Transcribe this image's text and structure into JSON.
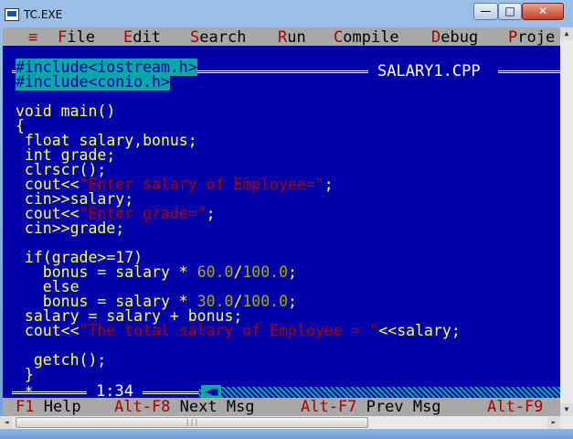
{
  "window": {
    "title": "TC.EXE",
    "minimize_glyph": "—",
    "maximize_glyph": "□",
    "close_glyph": "✕",
    "icon": "dos-app-icon"
  },
  "menu": {
    "system_glyph": "≡",
    "items": [
      {
        "hotkey": "F",
        "rest": "ile"
      },
      {
        "hotkey": "E",
        "rest": "dit"
      },
      {
        "hotkey": "S",
        "rest": "earch"
      },
      {
        "hotkey": "R",
        "rest": "un"
      },
      {
        "hotkey": "C",
        "rest": "ompile"
      },
      {
        "hotkey": "D",
        "rest": "ebug"
      },
      {
        "hotkey": "P",
        "rest": "roje"
      }
    ]
  },
  "editor": {
    "close_box_open": "[",
    "close_box_mark": "■",
    "close_box_close": "]",
    "file_name": "SALARY1.CPP",
    "cursor_position": "1:34",
    "scroll_left_glyph": "◄■",
    "lines": [
      [
        {
          "t": "#include<iostream.h>",
          "c": "inc"
        }
      ],
      [
        {
          "t": "#include<conio.h>",
          "c": "inc"
        }
      ],
      [
        {
          "t": "",
          "c": "plain"
        }
      ],
      [
        {
          "t": "void main()",
          "c": "plain"
        }
      ],
      [
        {
          "t": "{",
          "c": "plain"
        }
      ],
      [
        {
          "t": " float salary,bonus;",
          "c": "plain"
        }
      ],
      [
        {
          "t": " int grade;",
          "c": "plain"
        }
      ],
      [
        {
          "t": " clrscr();",
          "c": "plain"
        }
      ],
      [
        {
          "t": " cout<<",
          "c": "plain"
        },
        {
          "t": "\"Enter salary of Employee=\"",
          "c": "str"
        },
        {
          "t": ";",
          "c": "plain"
        }
      ],
      [
        {
          "t": " cin>>salary;",
          "c": "plain"
        }
      ],
      [
        {
          "t": " cout<<",
          "c": "plain"
        },
        {
          "t": "\"Enter grade=\"",
          "c": "str"
        },
        {
          "t": ";",
          "c": "plain"
        }
      ],
      [
        {
          "t": " cin>>grade;",
          "c": "plain"
        }
      ],
      [
        {
          "t": "",
          "c": "plain"
        }
      ],
      [
        {
          "t": " if(grade>=17)",
          "c": "plain"
        }
      ],
      [
        {
          "t": "   bonus = salary * ",
          "c": "plain"
        },
        {
          "t": "60.0",
          "c": "num"
        },
        {
          "t": "/",
          "c": "plain"
        },
        {
          "t": "100.0",
          "c": "num"
        },
        {
          "t": ";",
          "c": "plain"
        }
      ],
      [
        {
          "t": "   else",
          "c": "plain"
        }
      ],
      [
        {
          "t": "   bonus = salary * ",
          "c": "plain"
        },
        {
          "t": "30.0",
          "c": "num"
        },
        {
          "t": "/",
          "c": "plain"
        },
        {
          "t": "100.0",
          "c": "num"
        },
        {
          "t": ";",
          "c": "plain"
        }
      ],
      [
        {
          "t": " salary = salary + bonus;",
          "c": "plain"
        }
      ],
      [
        {
          "t": " cout<<",
          "c": "plain"
        },
        {
          "t": "\"The total salary of Employee = \"",
          "c": "str"
        },
        {
          "t": "<<salary;",
          "c": "plain"
        }
      ],
      [
        {
          "t": "",
          "c": "plain"
        }
      ],
      [
        {
          "t": "  getch();",
          "c": "plain"
        }
      ],
      [
        {
          "t": " }",
          "c": "plain"
        }
      ]
    ]
  },
  "statusbar": [
    {
      "key": "F1",
      "text": " Help"
    },
    {
      "key": "Alt-F8",
      "text": " Next Msg"
    },
    {
      "key": "Alt-F7",
      "text": " Prev Msg"
    },
    {
      "key": "Alt-F9",
      "text": ""
    }
  ],
  "scrollbars": {
    "up_glyph": "▲",
    "down_glyph": "▼",
    "left_glyph": "◄",
    "right_glyph": "►",
    "thumb_grip": "|||"
  },
  "colors": {
    "console_bg": "#0000a8",
    "code_text": "#ffff55",
    "string_text": "#a80000",
    "number_text": "#a8a800",
    "include_bg": "#00a8a8",
    "menu_bg": "#a8a8a8",
    "hotkey": "#a80000"
  }
}
